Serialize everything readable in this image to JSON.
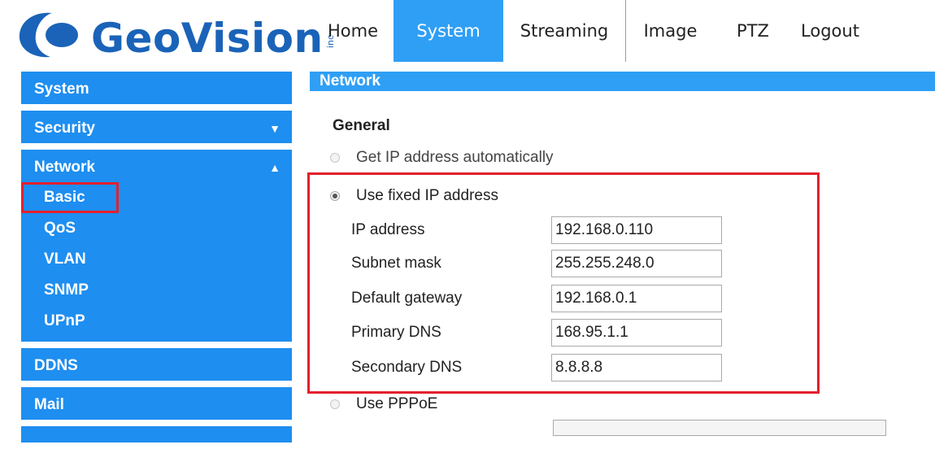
{
  "header": {
    "logo_text": "GeoVision",
    "logo_suffix": "inc",
    "nav": [
      {
        "label": "Home",
        "active": false
      },
      {
        "label": "System",
        "active": true
      },
      {
        "label": "Streaming",
        "active": false
      },
      {
        "label": "Image",
        "active": false
      },
      {
        "label": "PTZ",
        "active": false
      },
      {
        "label": "Logout",
        "active": false
      }
    ]
  },
  "sidebar": {
    "system": "System",
    "security": "Security",
    "network": "Network",
    "network_items": [
      "Basic",
      "QoS",
      "VLAN",
      "SNMP",
      "UPnP"
    ],
    "selected_item": "Basic",
    "ddns": "DDNS",
    "mail": "Mail"
  },
  "content": {
    "header": "Network",
    "section_title": "General",
    "options": {
      "auto": "Get IP address automatically",
      "fixed": "Use fixed IP address",
      "pppoe": "Use PPPoE"
    },
    "selected_option": "fixed",
    "fields": {
      "ip_address": {
        "label": "IP address",
        "value": "192.168.0.110"
      },
      "subnet_mask": {
        "label": "Subnet mask",
        "value": "255.255.248.0"
      },
      "default_gateway": {
        "label": "Default gateway",
        "value": "192.168.0.1"
      },
      "primary_dns": {
        "label": "Primary DNS",
        "value": "168.95.1.1"
      },
      "secondary_dns": {
        "label": "Secondary DNS",
        "value": "8.8.8.8"
      }
    }
  },
  "colors": {
    "brand": "#1a63b8",
    "sidebar_bg": "#1e8ef0",
    "active_tab": "#2f9ff5",
    "highlight": "#e2202d"
  }
}
